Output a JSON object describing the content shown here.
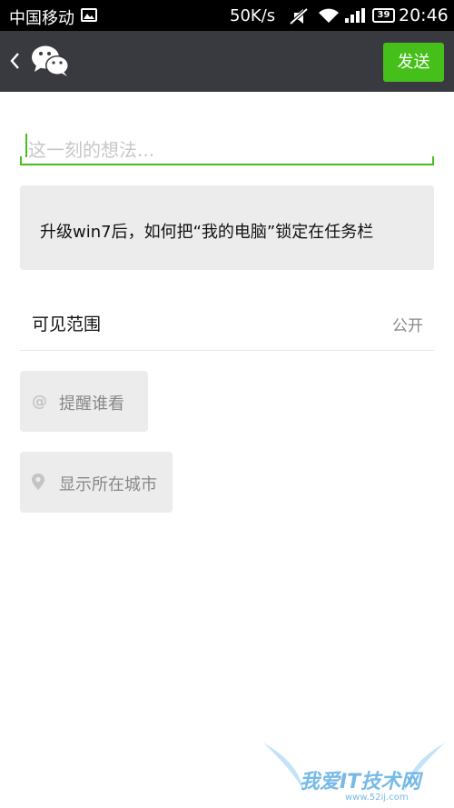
{
  "status_bar": {
    "carrier": "中国移动",
    "network_speed": "50K/s",
    "battery": "39",
    "time": "20:46",
    "icons": [
      "gallery-icon",
      "mute-icon",
      "wifi-icon",
      "signal-icon",
      "battery-icon"
    ]
  },
  "action_bar": {
    "back_icon": "chevron-left-icon",
    "logo_icon": "wechat-logo-icon",
    "send_label": "发送",
    "background": "#393a3f",
    "accent": "#45c01a"
  },
  "compose": {
    "placeholder": "这一刻的想法..."
  },
  "shared_link": {
    "title": "升级win7后，如何把“我的电脑”锁定在任务栏"
  },
  "visibility": {
    "label": "可见范围",
    "value": "公开"
  },
  "chips": {
    "mention": {
      "icon": "at-icon",
      "label": "提醒谁看"
    },
    "location": {
      "icon": "location-pin-icon",
      "label": "显示所在城市"
    }
  },
  "watermark": {
    "text": "我爱IT技术网",
    "sub": "www.52ij.com"
  }
}
